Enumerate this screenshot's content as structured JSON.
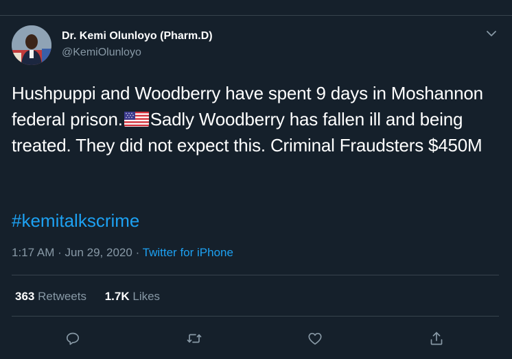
{
  "author": {
    "name": "Dr. Kemi Olunloyo (Pharm.D)",
    "handle": "@KemiOlunloyo"
  },
  "tweet": {
    "text_part1": "Hushpuppi and Woodberry have spent 9 days in Moshannon federal prison.",
    "flag_icon": "us-flag-emoji",
    "text_part2": "Sadly Woodberry has fallen ill and being treated. They did not expect this. Criminal Fraudsters $450M",
    "hashtag": "#kemitalkscrime"
  },
  "meta": {
    "time": "1:17 AM",
    "separator1": "·",
    "date": "Jun 29, 2020",
    "separator2": "·",
    "source": "Twitter for iPhone"
  },
  "stats": {
    "retweets_count": "363",
    "retweets_label": "Retweets",
    "likes_count": "1.7K",
    "likes_label": "Likes"
  },
  "actions": [
    "reply-icon",
    "retweet-icon",
    "like-icon",
    "share-icon"
  ],
  "colors": {
    "background": "#15202b",
    "accent": "#1da1f2",
    "secondary_text": "#8899a6",
    "divider": "#38444d"
  }
}
